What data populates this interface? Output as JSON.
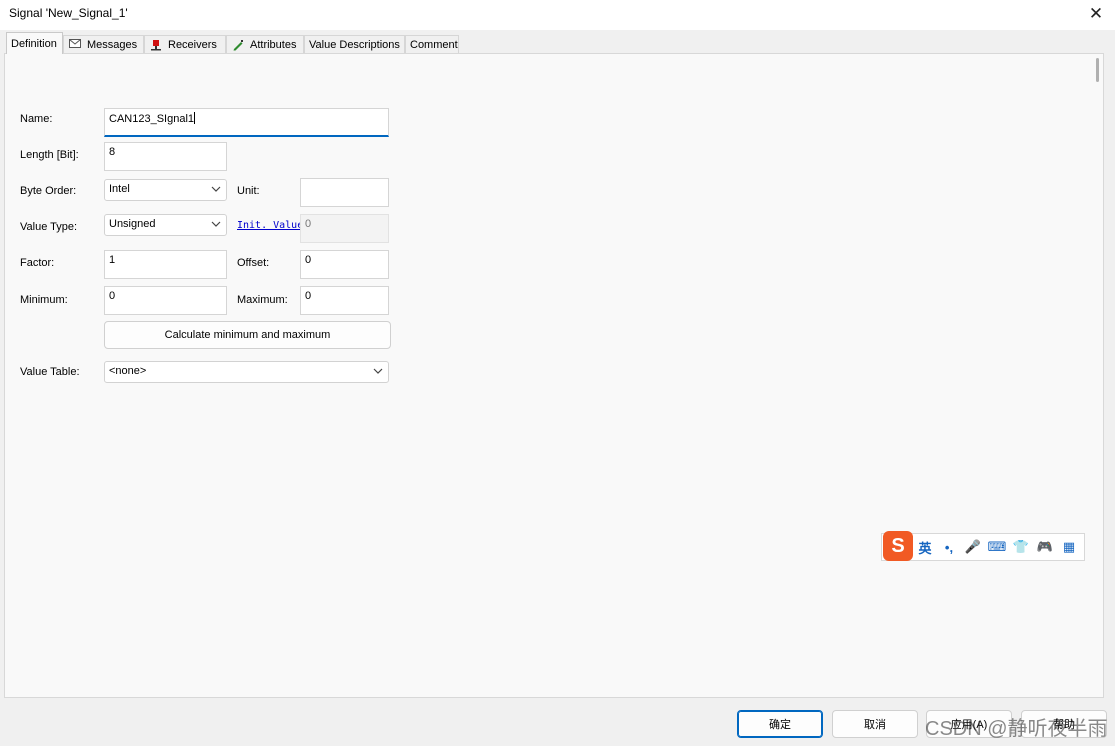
{
  "window": {
    "title": "Signal 'New_Signal_1'",
    "close_glyph": "✕"
  },
  "tabs": [
    {
      "label": "Definition",
      "icon": ""
    },
    {
      "label": "Messages",
      "icon": "envelope-icon"
    },
    {
      "label": "Receivers",
      "icon": "receiver-icon"
    },
    {
      "label": "Attributes",
      "icon": "pencil-icon"
    },
    {
      "label": "Value Descriptions",
      "icon": ""
    },
    {
      "label": "Comment",
      "icon": ""
    }
  ],
  "form": {
    "name": {
      "label": "Name:",
      "value": "CAN123_SIgnal1"
    },
    "length": {
      "label": "Length [Bit]:",
      "value": "8"
    },
    "byte_order": {
      "label": "Byte Order:",
      "value": "Intel"
    },
    "unit": {
      "label": "Unit:",
      "value": ""
    },
    "value_type": {
      "label": "Value Type:",
      "value": "Unsigned"
    },
    "init_value": {
      "label": "Init. Value",
      "value": "0"
    },
    "factor": {
      "label": "Factor:",
      "value": "1"
    },
    "offset": {
      "label": "Offset:",
      "value": "0"
    },
    "minimum": {
      "label": "Minimum:",
      "value": "0"
    },
    "maximum": {
      "label": "Maximum:",
      "value": "0"
    },
    "calc_button": "Calculate minimum and maximum",
    "value_table": {
      "label": "Value Table:",
      "value": "<none>"
    }
  },
  "ime_toolbar": {
    "logo": "S",
    "mode": "英",
    "punct": "•,",
    "mic": "🎤",
    "keyboard": "⌨",
    "shirt": "👕",
    "gamepad": "🎮",
    "grid": "▦"
  },
  "buttons": {
    "ok": "确定",
    "cancel": "取消",
    "apply": "应用(A)",
    "help": "帮助"
  },
  "watermark": "CSDN @静听夜半雨",
  "colors": {
    "accent": "#0067c0",
    "link": "#0000cc",
    "ime_logo": "#f15a24"
  }
}
